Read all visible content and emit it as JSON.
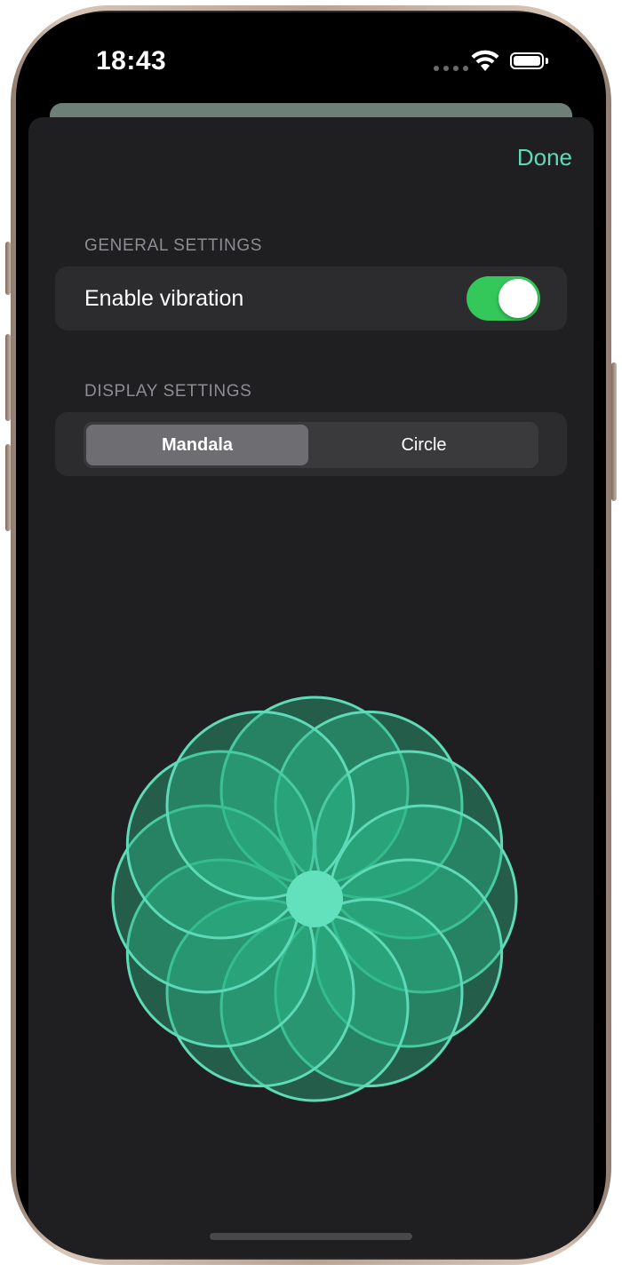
{
  "status_bar": {
    "time": "18:43",
    "signal_icon": "cellular-dots-icon",
    "wifi_icon": "wifi-icon",
    "battery_icon": "battery-icon",
    "battery_level": 1.0
  },
  "header": {
    "done_label": "Done"
  },
  "general_settings": {
    "header": "GENERAL SETTINGS",
    "vibration_label": "Enable vibration",
    "vibration_enabled": true
  },
  "display_settings": {
    "header": "DISPLAY SETTINGS",
    "options": [
      "Mandala",
      "Circle"
    ],
    "selected": "Mandala"
  },
  "mandala": {
    "petal_count": 12,
    "accent_color": "#5fdab7",
    "fill_color": "#2bb486",
    "center_color": "#63e0bc"
  },
  "colors": {
    "accent": "#5fdab7",
    "toggle_on": "#34c759",
    "sheet_bg": "#1f1f21",
    "card_bg": "#2c2c2e"
  }
}
